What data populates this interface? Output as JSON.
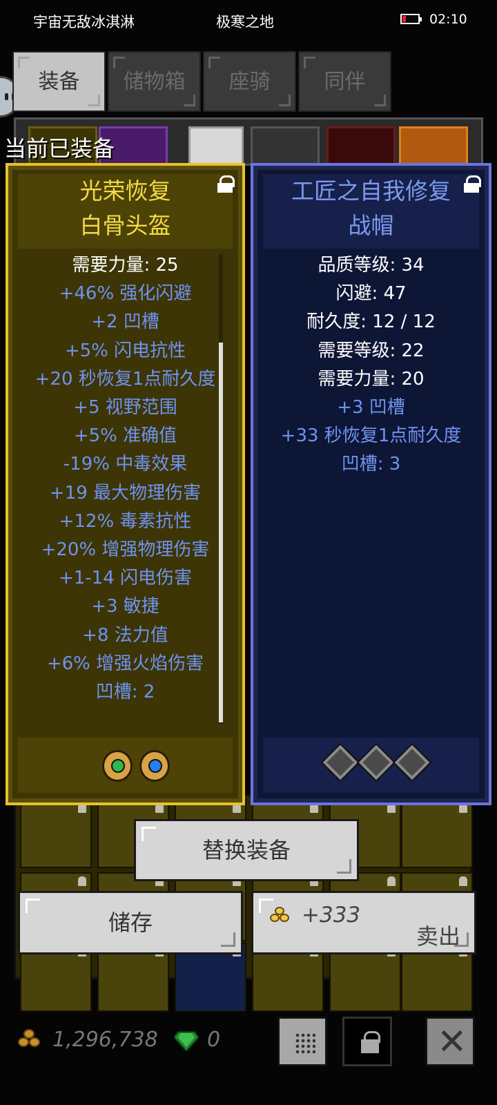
{
  "status_bar": {
    "left_text": "宇宙无敌冰淇淋",
    "center_text": "极寒之地",
    "time": "02:10"
  },
  "tabs": [
    {
      "label": "装备",
      "active": true
    },
    {
      "label": "储物箱",
      "active": false
    },
    {
      "label": "座骑",
      "active": false
    },
    {
      "label": "同伴",
      "active": false
    }
  ],
  "equipped_label": "当前已装备",
  "item_selected": {
    "name_line1": "光荣恢复",
    "name_line2": "白骨头盔",
    "rarity_color": "#f2dc45",
    "stats": [
      {
        "text": "需要力量: 25",
        "kind": "white"
      },
      {
        "text": "+46% 强化闪避",
        "kind": "blue"
      },
      {
        "text": "+2 凹槽",
        "kind": "blue"
      },
      {
        "text": "+5% 闪电抗性",
        "kind": "blue"
      },
      {
        "text": "+20 秒恢复1点耐久度",
        "kind": "blue"
      },
      {
        "text": "+5 视野范围",
        "kind": "blue"
      },
      {
        "text": "+5% 准确值",
        "kind": "blue"
      },
      {
        "text": "-19% 中毒效果",
        "kind": "blue"
      },
      {
        "text": "+19 最大物理伤害",
        "kind": "blue"
      },
      {
        "text": "+12% 毒素抗性",
        "kind": "blue"
      },
      {
        "text": "+20% 增强物理伤害",
        "kind": "blue"
      },
      {
        "text": "+1-14 闪电伤害",
        "kind": "blue"
      },
      {
        "text": "+3 敏捷",
        "kind": "blue"
      },
      {
        "text": "+8 法力值",
        "kind": "blue"
      },
      {
        "text": "+6% 增强火焰伤害",
        "kind": "blue"
      },
      {
        "text": "凹槽: 2",
        "kind": "blue"
      }
    ],
    "gems": [
      "green-gem-icon",
      "blue-gem-icon"
    ]
  },
  "item_equipped": {
    "name_line1": "工匠之自我修复",
    "name_line2": "战帽",
    "rarity_color": "#7b9af0",
    "stats": [
      {
        "text": "品质等级: 34",
        "kind": "white"
      },
      {
        "text": "闪避: 47",
        "kind": "white"
      },
      {
        "text": "耐久度: 12 / 12",
        "kind": "white"
      },
      {
        "text": "需要等级: 22",
        "kind": "white"
      },
      {
        "text": "需要力量: 20",
        "kind": "white"
      },
      {
        "text": "+3 凹槽",
        "kind": "blue"
      },
      {
        "text": "+33 秒恢复1点耐久度",
        "kind": "blue"
      },
      {
        "text": "凹槽: 3",
        "kind": "blue"
      }
    ],
    "empty_sockets": 3
  },
  "actions": {
    "replace_label": "替换装备",
    "store_label": "储存",
    "sell_price": "+333",
    "sell_label": "卖出"
  },
  "currency": {
    "gold": "1,296,738",
    "gems": "0"
  }
}
